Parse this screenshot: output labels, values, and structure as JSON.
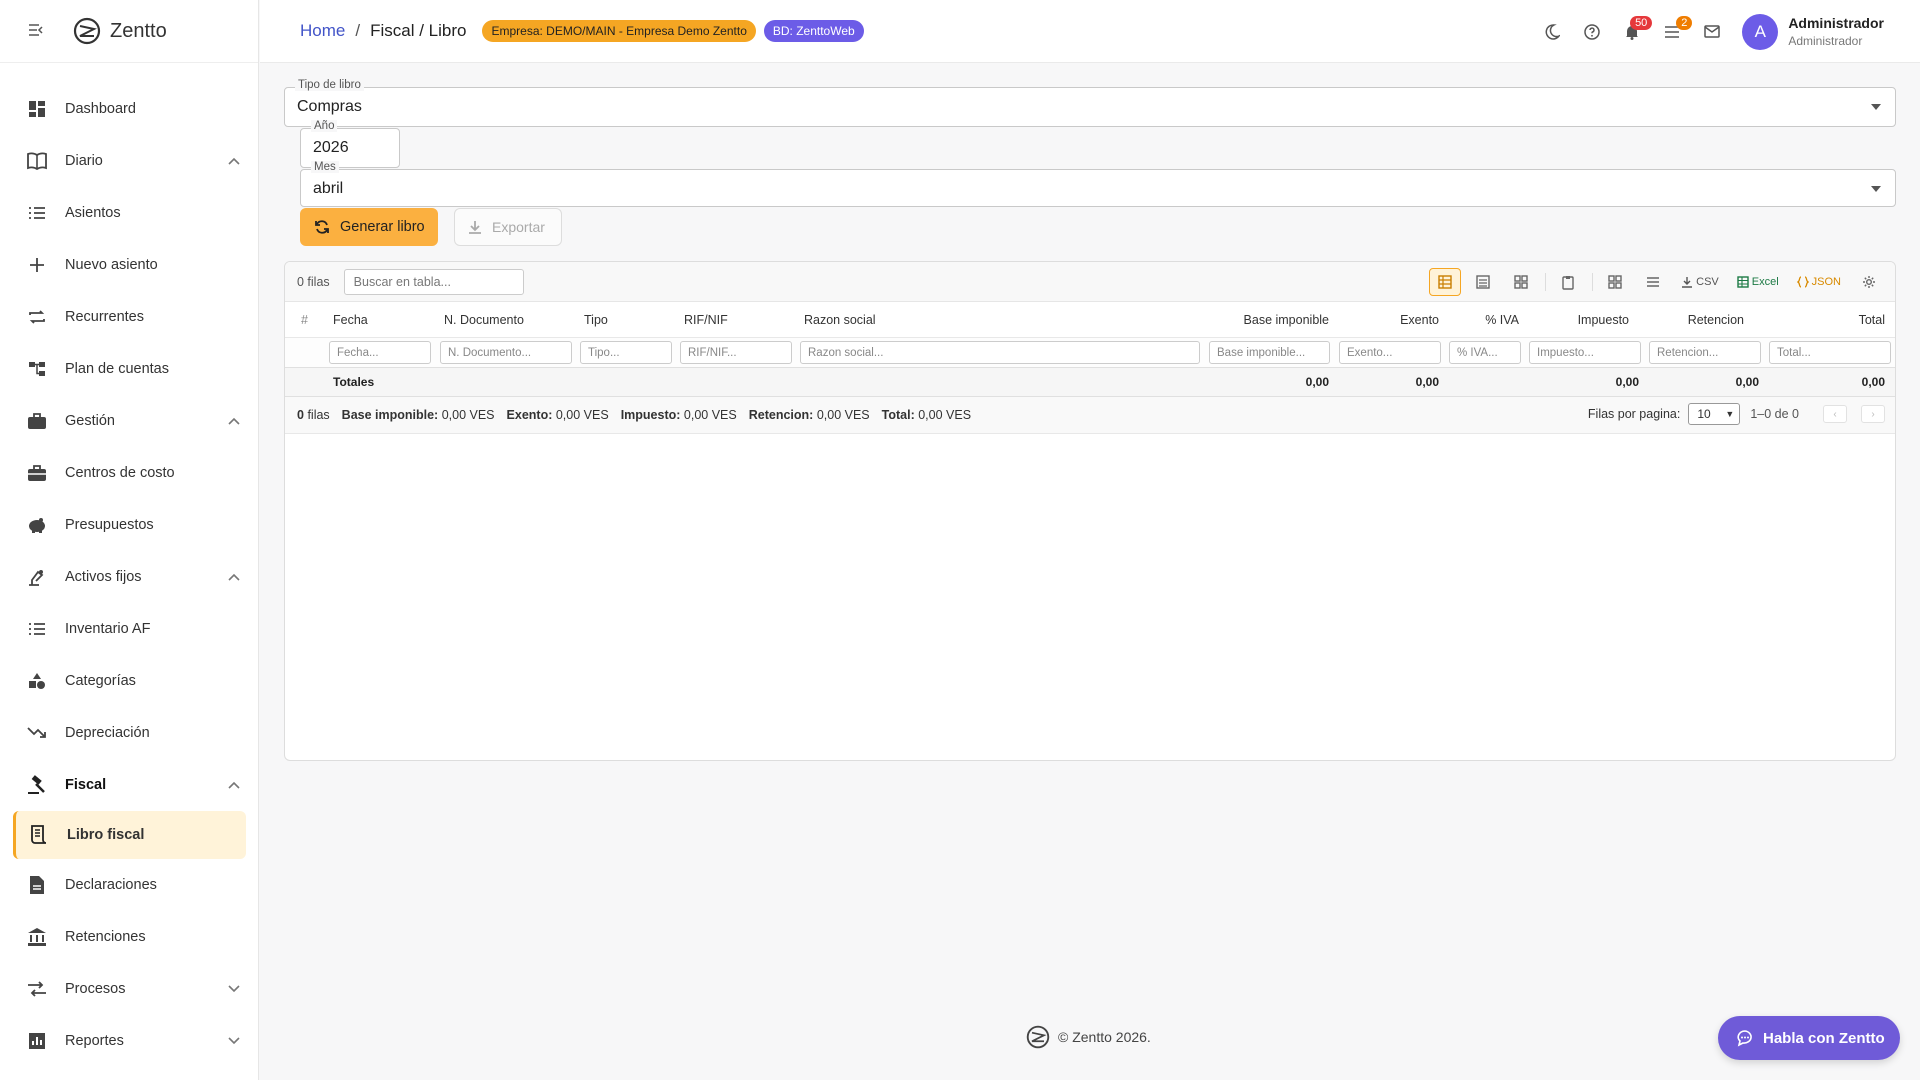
{
  "brand": {
    "name": "Zentto"
  },
  "sidebar": {
    "items": [
      {
        "label": "Dashboard"
      },
      {
        "label": "Diario"
      },
      {
        "label": "Asientos"
      },
      {
        "label": "Nuevo asiento"
      },
      {
        "label": "Recurrentes"
      },
      {
        "label": "Plan de cuentas"
      },
      {
        "label": "Gestión"
      },
      {
        "label": "Centros de costo"
      },
      {
        "label": "Presupuestos"
      },
      {
        "label": "Activos fijos"
      },
      {
        "label": "Inventario AF"
      },
      {
        "label": "Categorías"
      },
      {
        "label": "Depreciación"
      },
      {
        "label": "Fiscal"
      },
      {
        "label": "Libro fiscal"
      },
      {
        "label": "Declaraciones"
      },
      {
        "label": "Retenciones"
      },
      {
        "label": "Procesos"
      },
      {
        "label": "Reportes"
      }
    ]
  },
  "header": {
    "breadcrumb_home": "Home",
    "breadcrumb_sep": "/",
    "breadcrumb_current": "Fiscal / Libro",
    "empresa_badge": "Empresa: DEMO/MAIN - Empresa Demo Zentto",
    "bd_badge": "BD: ZenttoWeb",
    "notifications_count": "50",
    "tasks_count": "2",
    "user_initial": "A",
    "user_name": "Administrador",
    "user_role": "Administrador"
  },
  "form": {
    "tipo_label": "Tipo de libro",
    "tipo_value": "Compras",
    "anio_label": "Año",
    "anio_value": "2026",
    "mes_label": "Mes",
    "mes_value": "abril",
    "generar_label": "Generar libro",
    "exportar_label": "Exportar"
  },
  "table": {
    "row_count": "0 filas",
    "search_placeholder": "Buscar en tabla...",
    "export_csv": "CSV",
    "export_excel": "Excel",
    "export_json": "JSON",
    "columns": {
      "num": "#",
      "fecha": "Fecha",
      "ndoc": "N. Documento",
      "tipo": "Tipo",
      "rif": "RIF/NIF",
      "razon": "Razon social",
      "base": "Base imponible",
      "exento": "Exento",
      "iva": "% IVA",
      "impuesto": "Impuesto",
      "retencion": "Retencion",
      "total": "Total"
    },
    "filters": {
      "fecha": "Fecha...",
      "ndoc": "N. Documento...",
      "tipo": "Tipo...",
      "rif": "RIF/NIF...",
      "razon": "Razon social...",
      "base": "Base imponible...",
      "exento": "Exento...",
      "iva": "% IVA...",
      "impuesto": "Impuesto...",
      "retencion": "Retencion...",
      "total": "Total..."
    },
    "totals": {
      "label": "Totales",
      "base": "0,00",
      "exento": "0,00",
      "impuesto": "0,00",
      "retencion": "0,00",
      "total": "0,00"
    },
    "footer": {
      "count_num": "0",
      "count_word": "filas",
      "base_label": "Base imponible:",
      "base_value": "0,00 VES",
      "exento_label": "Exento:",
      "exento_value": "0,00 VES",
      "impuesto_label": "Impuesto:",
      "impuesto_value": "0,00 VES",
      "retencion_label": "Retencion:",
      "retencion_value": "0,00 VES",
      "total_label": "Total:",
      "total_value": "0,00 VES",
      "rows_per_page_label": "Filas por pagina:",
      "rows_per_page": "10",
      "range": "1–0 de 0"
    }
  },
  "footer": {
    "copyright": "© Zentto 2026."
  },
  "chat": {
    "label": "Habla con Zentto"
  },
  "colors": {
    "accent": "#f5a623",
    "primary": "#6c5ce7",
    "link": "#4254c8"
  }
}
